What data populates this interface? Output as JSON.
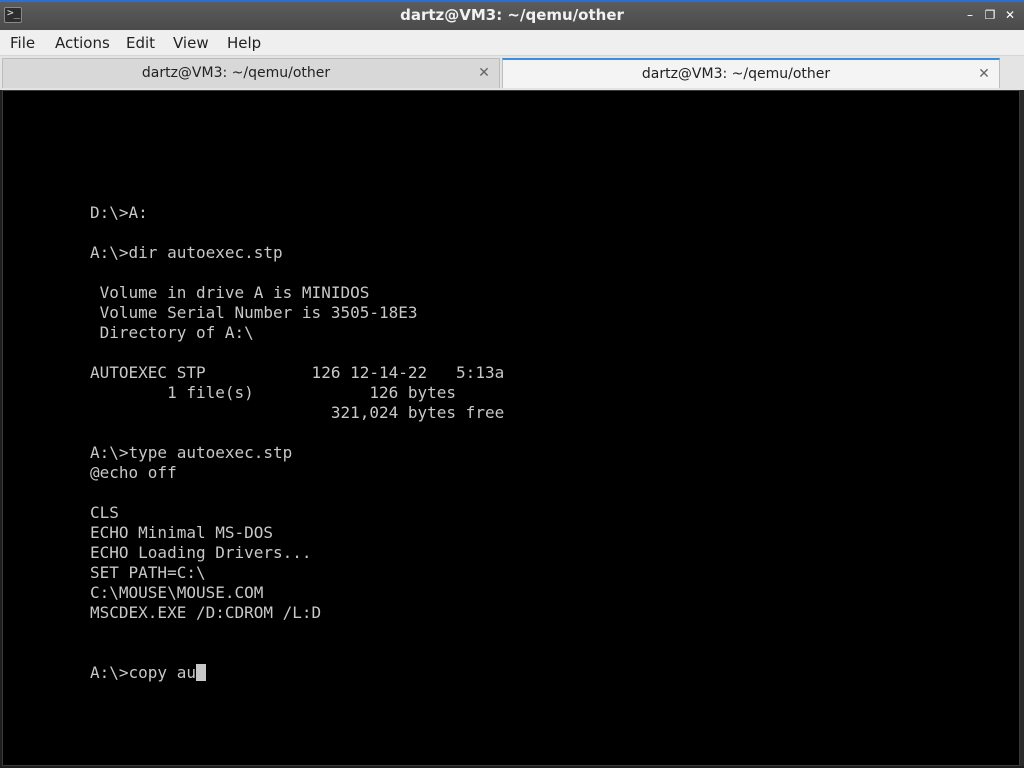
{
  "window": {
    "title": "dartz@VM3: ~/qemu/other",
    "icon": "terminal-icon",
    "controls": {
      "minimize": "–",
      "restore": "❐",
      "close": "✕"
    }
  },
  "menubar": {
    "file": "File",
    "actions": "Actions",
    "edit": "Edit",
    "view": "View",
    "help": "Help"
  },
  "tabs": [
    {
      "label": "dartz@VM3: ~/qemu/other",
      "active": false
    },
    {
      "label": "dartz@VM3: ~/qemu/other",
      "active": true
    }
  ],
  "tab_close_glyph": "✕",
  "terminal": {
    "lines": [
      "",
      "",
      "",
      "",
      "",
      "D:\\>A:",
      "",
      "A:\\>dir autoexec.stp",
      "",
      " Volume in drive A is MINIDOS",
      " Volume Serial Number is 3505-18E3",
      " Directory of A:\\",
      "",
      "AUTOEXEC STP           126 12-14-22   5:13a",
      "        1 file(s)            126 bytes",
      "                         321,024 bytes free",
      "",
      "A:\\>type autoexec.stp",
      "@echo off",
      "",
      "CLS",
      "ECHO Minimal MS-DOS",
      "ECHO Loading Drivers...",
      "SET PATH=C:\\",
      "C:\\MOUSE\\MOUSE.COM",
      "MSCDEX.EXE /D:CDROM /L:D",
      "",
      ""
    ],
    "prompt_input": "A:\\>copy au"
  }
}
